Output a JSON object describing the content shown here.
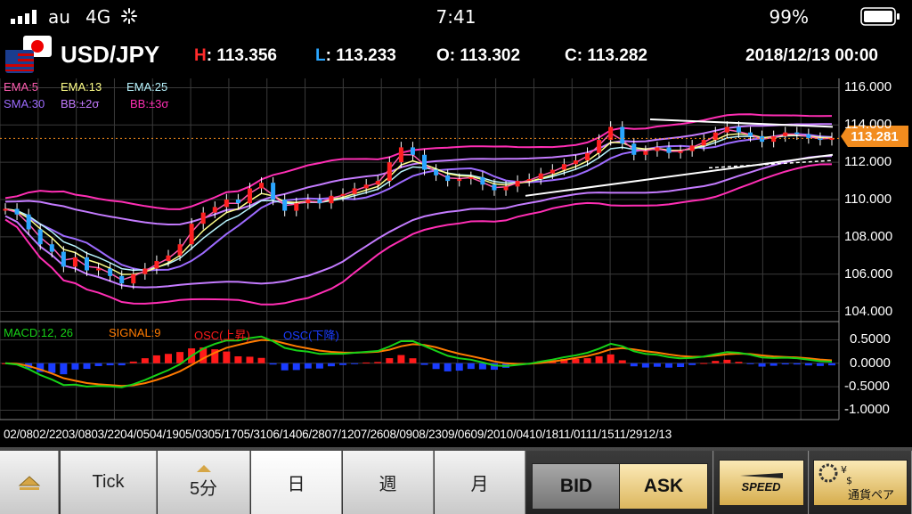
{
  "status_bar": {
    "carrier": "au",
    "network": "4G",
    "time": "7:41",
    "battery": "99%"
  },
  "header": {
    "pair": "USD/JPY",
    "high_label": "H",
    "high": ": 113.356",
    "low_label": "L",
    "low": ": 113.233",
    "open_label": "O",
    "open": ": 113.302",
    "close_label": "C",
    "close": ": 113.282",
    "datetime": "2018/12/13 00:00"
  },
  "indicators": {
    "ema5": "EMA:5",
    "ema13": "EMA:13",
    "ema25": "EMA:25",
    "sma30": "SMA:30",
    "bb2": "BB:±2σ",
    "bb3": "BB:±3σ"
  },
  "macd_legend": {
    "macd": "MACD:12, 26",
    "signal": "SIGNAL:9",
    "osc_up": "OSC(上昇)",
    "osc_down": "OSC(下降)"
  },
  "chart_data": {
    "type": "line",
    "price_axis": [
      "116.000",
      "114.000",
      "112.000",
      "110.000",
      "108.000",
      "106.000",
      "104.000"
    ],
    "current_price": "113.281",
    "macd_axis": [
      "0.5000",
      "0.0000",
      "-0.5000",
      "-1.0000"
    ],
    "x_labels": [
      "02/08",
      "02/22",
      "03/08",
      "03/22",
      "04/05",
      "04/19",
      "05/03",
      "05/17",
      "05/31",
      "06/14",
      "06/28",
      "07/12",
      "07/26",
      "08/09",
      "08/23",
      "09/06",
      "09/20",
      "10/04",
      "10/18",
      "11/01",
      "11/15",
      "11/29",
      "12/13"
    ],
    "ylim": [
      103.5,
      116.5
    ],
    "macd_ylim": [
      -1.2,
      0.85
    ],
    "close": [
      109.5,
      109.2,
      108.4,
      107.6,
      107.2,
      106.4,
      106.9,
      106.2,
      106.3,
      105.9,
      105.5,
      106.0,
      106.3,
      106.7,
      107.0,
      107.6,
      108.7,
      109.3,
      109.6,
      110.0,
      109.8,
      110.6,
      110.9,
      110.0,
      109.4,
      109.8,
      110.0,
      109.8,
      110.2,
      110.3,
      110.6,
      110.8,
      111.0,
      112.0,
      112.8,
      112.4,
      111.6,
      111.3,
      111.0,
      111.1,
      111.2,
      110.8,
      110.5,
      110.7,
      111.0,
      111.1,
      111.4,
      111.6,
      111.9,
      112.1,
      112.5,
      113.2,
      113.9,
      113.0,
      112.4,
      112.6,
      112.8,
      112.5,
      112.6,
      112.9,
      113.2,
      113.6,
      113.9,
      113.6,
      113.4,
      113.1,
      113.4,
      113.6,
      113.5,
      113.3,
      113.2,
      113.3
    ],
    "macd_series_colors": {
      "macd": "#17d117",
      "signal": "#ff7b00",
      "osc_up": "#ff1a1a",
      "osc_down": "#1a3cff"
    }
  },
  "tabs": {
    "up_icon": "triangle-up-icon",
    "tick": "Tick",
    "min5": "5分",
    "day": "日",
    "week": "週",
    "month": "月",
    "bid": "BID",
    "ask": "ASK",
    "speed": "SPEED",
    "pair_select": "通貨ペア"
  },
  "colors": {
    "high": "#ff2b2b",
    "low": "#2aa6ff",
    "ema5": "#ff5db1",
    "ema13": "#ffff88",
    "ema25": "#b8f5ff",
    "sma30": "#9d6bff",
    "bb2": "#c47bff",
    "bb3": "#ff2eb4",
    "price_tag": "#f28c1e"
  }
}
